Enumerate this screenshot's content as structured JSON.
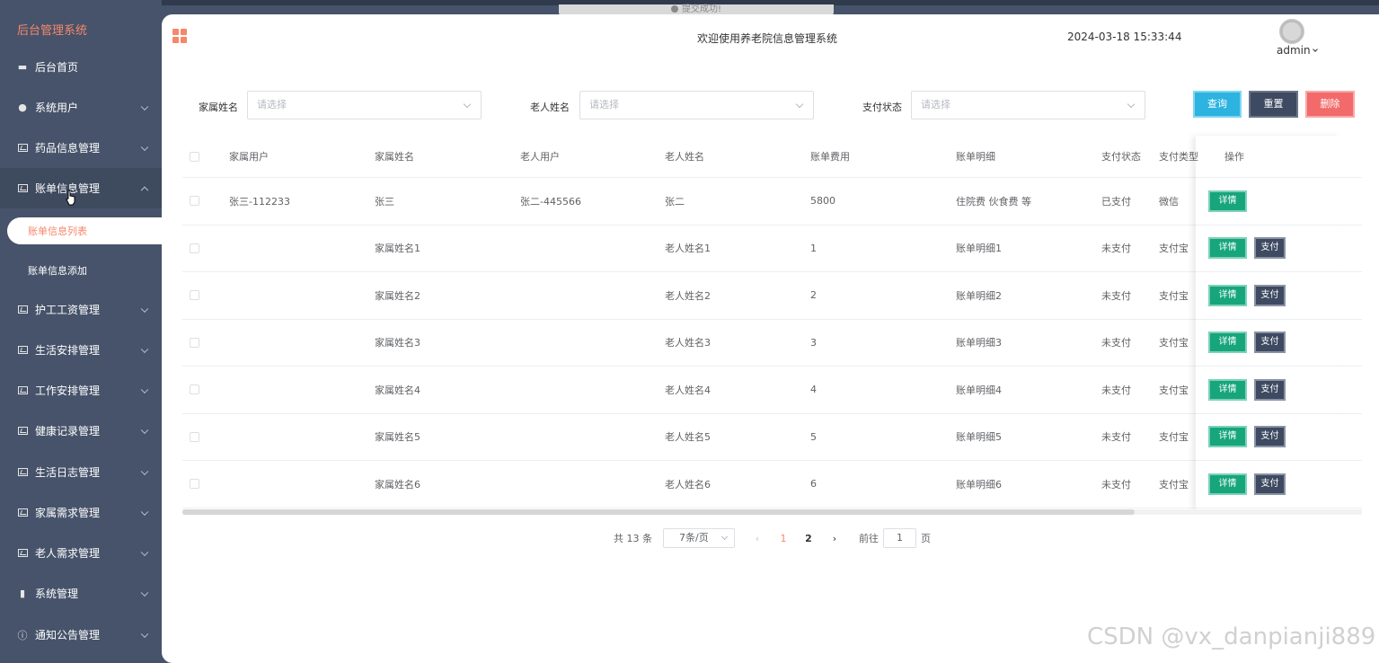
{
  "top_chip": "提交成功!",
  "sidebar": {
    "title": "后台管理系统",
    "items": [
      {
        "label": "后台首页",
        "icon": "monitor-icon"
      },
      {
        "label": "系统用户",
        "icon": "user-icon"
      },
      {
        "label": "药品信息管理",
        "icon": "chart-icon"
      },
      {
        "label": "账单信息管理",
        "icon": "chart-icon"
      },
      {
        "label": "护工工资管理",
        "icon": "chart-icon"
      },
      {
        "label": "生活安排管理",
        "icon": "chart-icon"
      },
      {
        "label": "工作安排管理",
        "icon": "chart-icon"
      },
      {
        "label": "健康记录管理",
        "icon": "chart-icon"
      },
      {
        "label": "生活日志管理",
        "icon": "chart-icon"
      },
      {
        "label": "家属需求管理",
        "icon": "chart-icon"
      },
      {
        "label": "老人需求管理",
        "icon": "chart-icon"
      },
      {
        "label": "系统管理",
        "icon": "bar-chart-icon"
      },
      {
        "label": "通知公告管理",
        "icon": "info-icon"
      }
    ],
    "subitems": [
      {
        "label": "账单信息列表"
      },
      {
        "label": "账单信息添加"
      }
    ]
  },
  "header": {
    "welcome": "欢迎使用养老院信息管理系统",
    "datetime": "2024-03-18 15:33:44",
    "username": "admin"
  },
  "filters": {
    "family_name_label": "家属姓名",
    "family_name_placeholder": "请选择",
    "elder_name_label": "老人姓名",
    "elder_name_placeholder": "请选择",
    "pay_status_label": "支付状态",
    "pay_status_placeholder": "请选择",
    "query": "查询",
    "reset": "重置",
    "delete": "删除"
  },
  "table": {
    "headers": [
      "家属用户",
      "家属姓名",
      "老人用户",
      "老人姓名",
      "账单费用",
      "账单明细",
      "支付状态",
      "支付类型",
      "操作"
    ],
    "rows": [
      {
        "family_user": "张三-112233",
        "family_name": "张三",
        "elder_user": "张二-445566",
        "elder_name": "张二",
        "fee": "5800",
        "detail": "住院费 伙食费 等",
        "status": "已支付",
        "type": "微信",
        "pay": false
      },
      {
        "family_user": "",
        "family_name": "家属姓名1",
        "elder_user": "",
        "elder_name": "老人姓名1",
        "fee": "1",
        "detail": "账单明细1",
        "status": "未支付",
        "type": "支付宝",
        "pay": true
      },
      {
        "family_user": "",
        "family_name": "家属姓名2",
        "elder_user": "",
        "elder_name": "老人姓名2",
        "fee": "2",
        "detail": "账单明细2",
        "status": "未支付",
        "type": "支付宝",
        "pay": true
      },
      {
        "family_user": "",
        "family_name": "家属姓名3",
        "elder_user": "",
        "elder_name": "老人姓名3",
        "fee": "3",
        "detail": "账单明细3",
        "status": "未支付",
        "type": "支付宝",
        "pay": true
      },
      {
        "family_user": "",
        "family_name": "家属姓名4",
        "elder_user": "",
        "elder_name": "老人姓名4",
        "fee": "4",
        "detail": "账单明细4",
        "status": "未支付",
        "type": "支付宝",
        "pay": true
      },
      {
        "family_user": "",
        "family_name": "家属姓名5",
        "elder_user": "",
        "elder_name": "老人姓名5",
        "fee": "5",
        "detail": "账单明细5",
        "status": "未支付",
        "type": "支付宝",
        "pay": true
      },
      {
        "family_user": "",
        "family_name": "家属姓名6",
        "elder_user": "",
        "elder_name": "老人姓名6",
        "fee": "6",
        "detail": "账单明细6",
        "status": "未支付",
        "type": "支付宝",
        "pay": true
      }
    ],
    "detail_label": "详情",
    "pay_label": "支付"
  },
  "pagination": {
    "total": "共 13 条",
    "page_size": "7条/页",
    "pages": [
      "1",
      "2"
    ],
    "current": "1",
    "goto_prefix": "前往",
    "goto_value": "1",
    "goto_suffix": "页"
  },
  "watermark": "CSDN @vx_danpianji889",
  "colors": {
    "sidebar_bg": "#46536a",
    "accent": "#f7866a",
    "query": "#2cb3e0",
    "reset": "#3d4a61",
    "delete": "#f26a6a",
    "detail": "#17a57c"
  }
}
